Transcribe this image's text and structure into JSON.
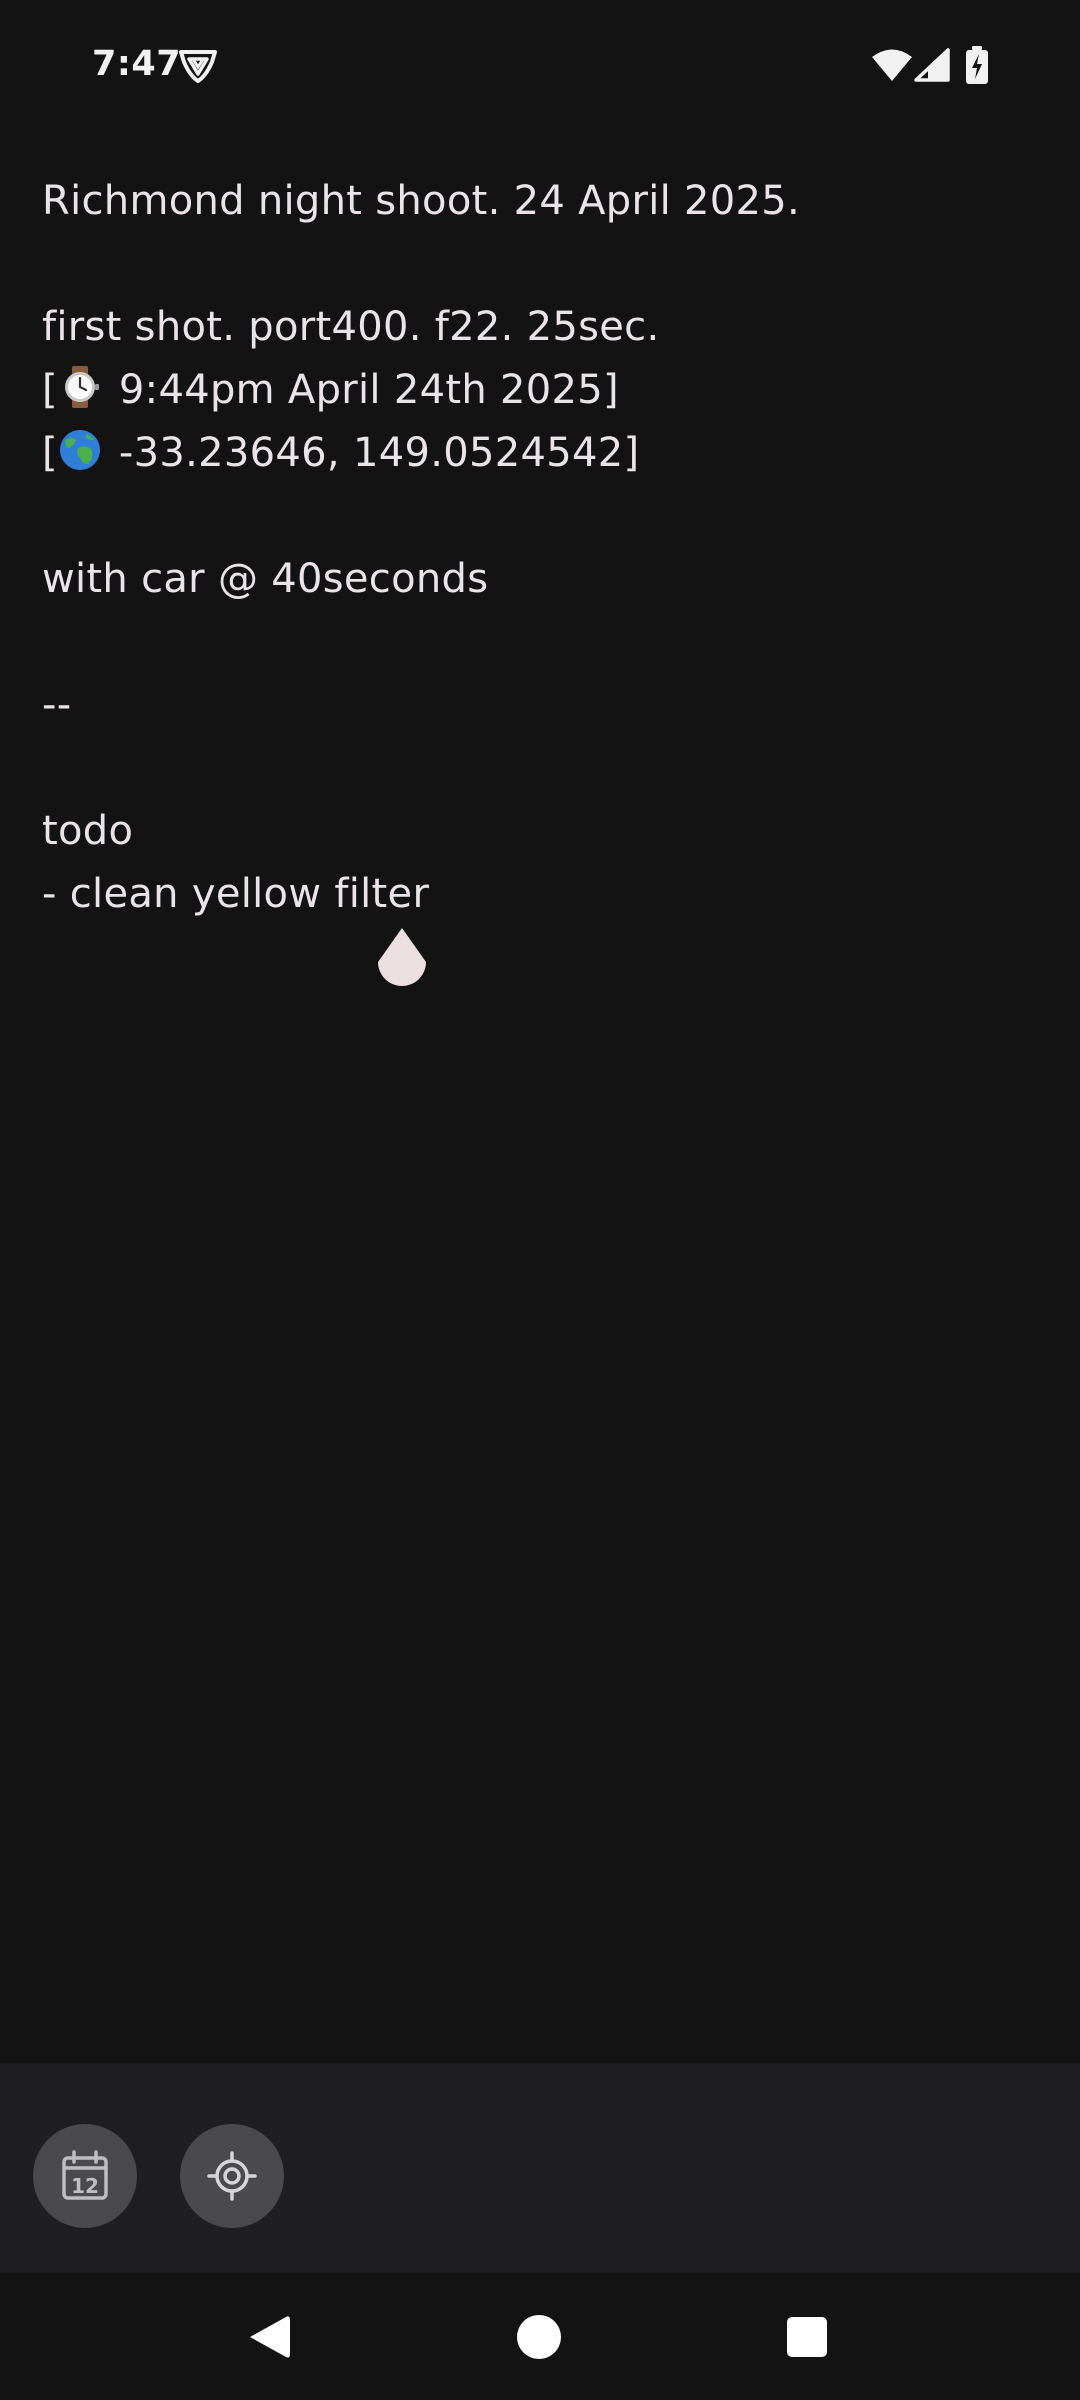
{
  "status_bar": {
    "time": "7:47",
    "icons": [
      "vpn-shield-icon",
      "wifi-icon",
      "cellular-signal-icon",
      "battery-charging-icon"
    ]
  },
  "note": {
    "lines": [
      "Richmond night shoot. 24 April 2025.",
      "",
      "first shot. port400. f22. 25sec.",
      "[⌚ 9:44pm April 24th 2025]",
      "[🌏 -33.23646, 149.0524542]",
      "",
      "with car @ 40seconds",
      "",
      "--",
      "",
      "todo",
      "- clean yellow filter"
    ],
    "watch_line": {
      "open": "[",
      "text": " 9:44pm April 24th 2025]",
      "icon": "watch-icon"
    },
    "globe_line": {
      "open": "[",
      "text": " -33.23646, 149.0524542]",
      "icon": "globe-icon"
    }
  },
  "toolbar": {
    "buttons": [
      {
        "icon": "calendar-icon",
        "label": "12"
      },
      {
        "icon": "location-target-icon"
      }
    ]
  },
  "nav": {
    "icons": [
      "back-icon",
      "home-icon",
      "recents-icon"
    ]
  },
  "colors": {
    "background": "#131314",
    "toolbar_bg": "#1f1f23",
    "button_bg": "#4a4a4d",
    "text": "#e9e4e7",
    "handle": "#ecdfe2"
  }
}
